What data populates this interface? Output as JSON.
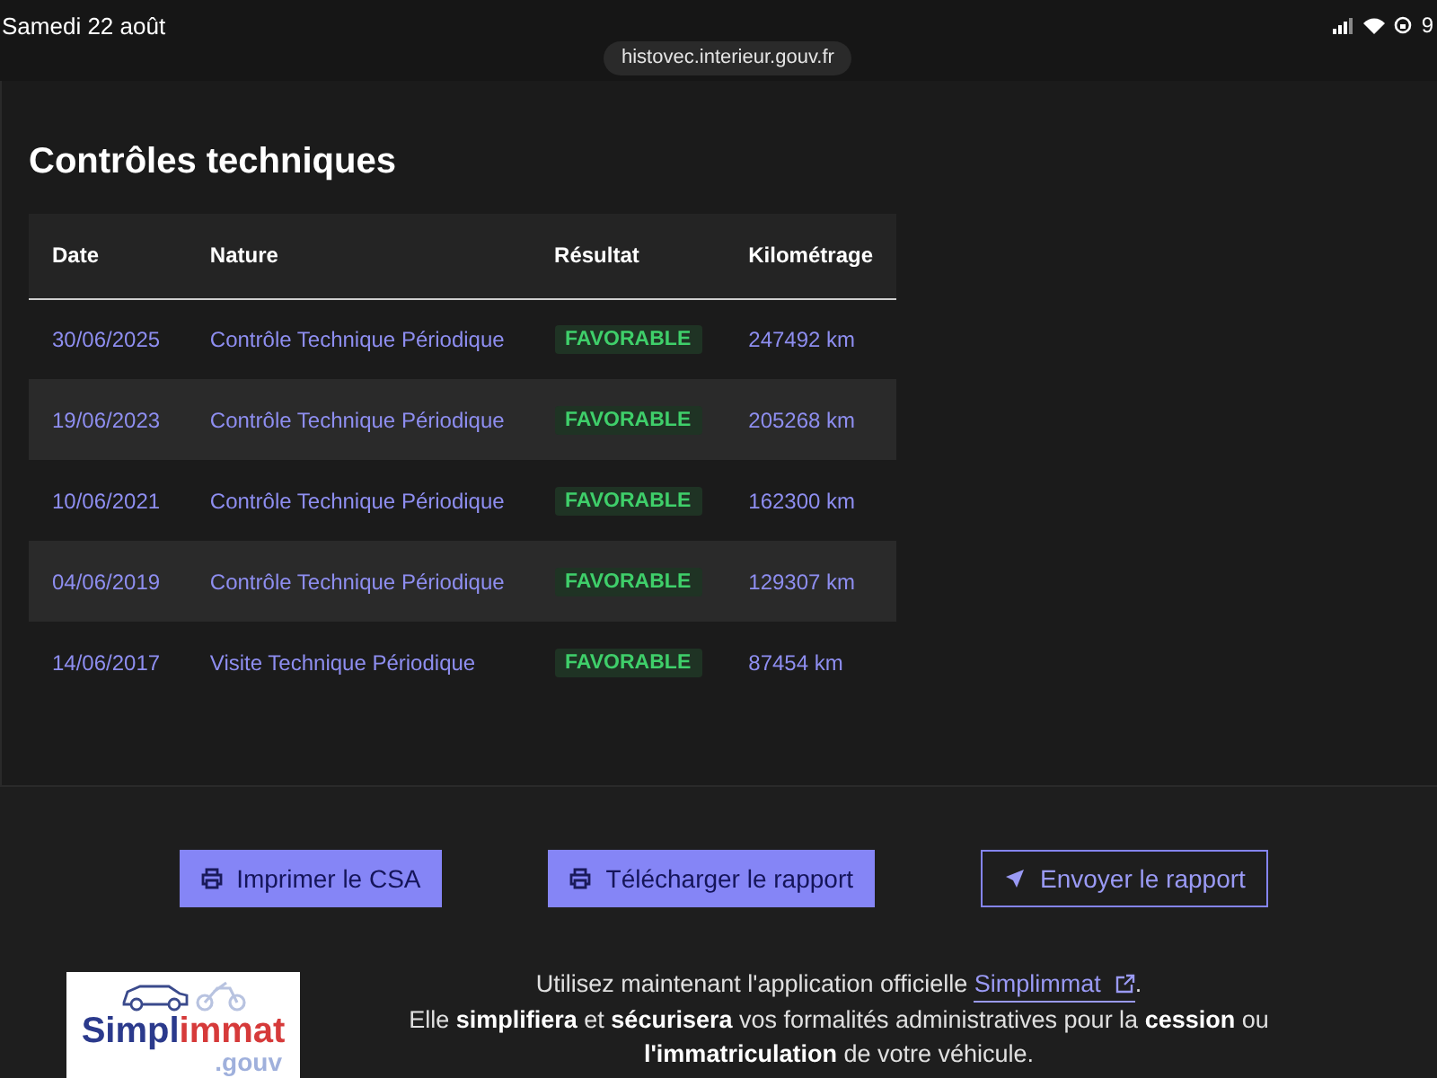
{
  "status_bar": {
    "date": "Samedi 22 août",
    "url": "histovec.interieur.gouv.fr",
    "battery": "9"
  },
  "section": {
    "title": "Contrôles techniques",
    "table": {
      "columns": [
        "Date",
        "Nature",
        "Résultat",
        "Kilométrage"
      ],
      "rows": [
        {
          "date": "30/06/2025",
          "nature": "Contrôle Technique Périodique",
          "result": "FAVORABLE",
          "km": "247492 km"
        },
        {
          "date": "19/06/2023",
          "nature": "Contrôle Technique Périodique",
          "result": "FAVORABLE",
          "km": "205268 km"
        },
        {
          "date": "10/06/2021",
          "nature": "Contrôle Technique Périodique",
          "result": "FAVORABLE",
          "km": "162300 km"
        },
        {
          "date": "04/06/2019",
          "nature": "Contrôle Technique Périodique",
          "result": "FAVORABLE",
          "km": "129307 km"
        },
        {
          "date": "14/06/2017",
          "nature": "Visite Technique Périodique",
          "result": "FAVORABLE",
          "km": "87454 km"
        }
      ]
    }
  },
  "buttons": [
    {
      "label": "Imprimer le CSA",
      "kind": "primary"
    },
    {
      "label": "Télécharger le rapport",
      "kind": "primary"
    },
    {
      "label": "Envoyer le rapport",
      "kind": "outline"
    }
  ],
  "promo": {
    "logo": {
      "word_a": "Simpl",
      "word_b": "immat",
      "suffix": ".gouv"
    },
    "before": "Utilisez maintenant l'application officielle ",
    "link": "Simplimmat",
    "after": ".",
    "line2": "Elle **simplifiera** et **sécurisera** vos formalités administratives pour la **cession** ou **l'immatriculation** de votre véhicule."
  }
}
